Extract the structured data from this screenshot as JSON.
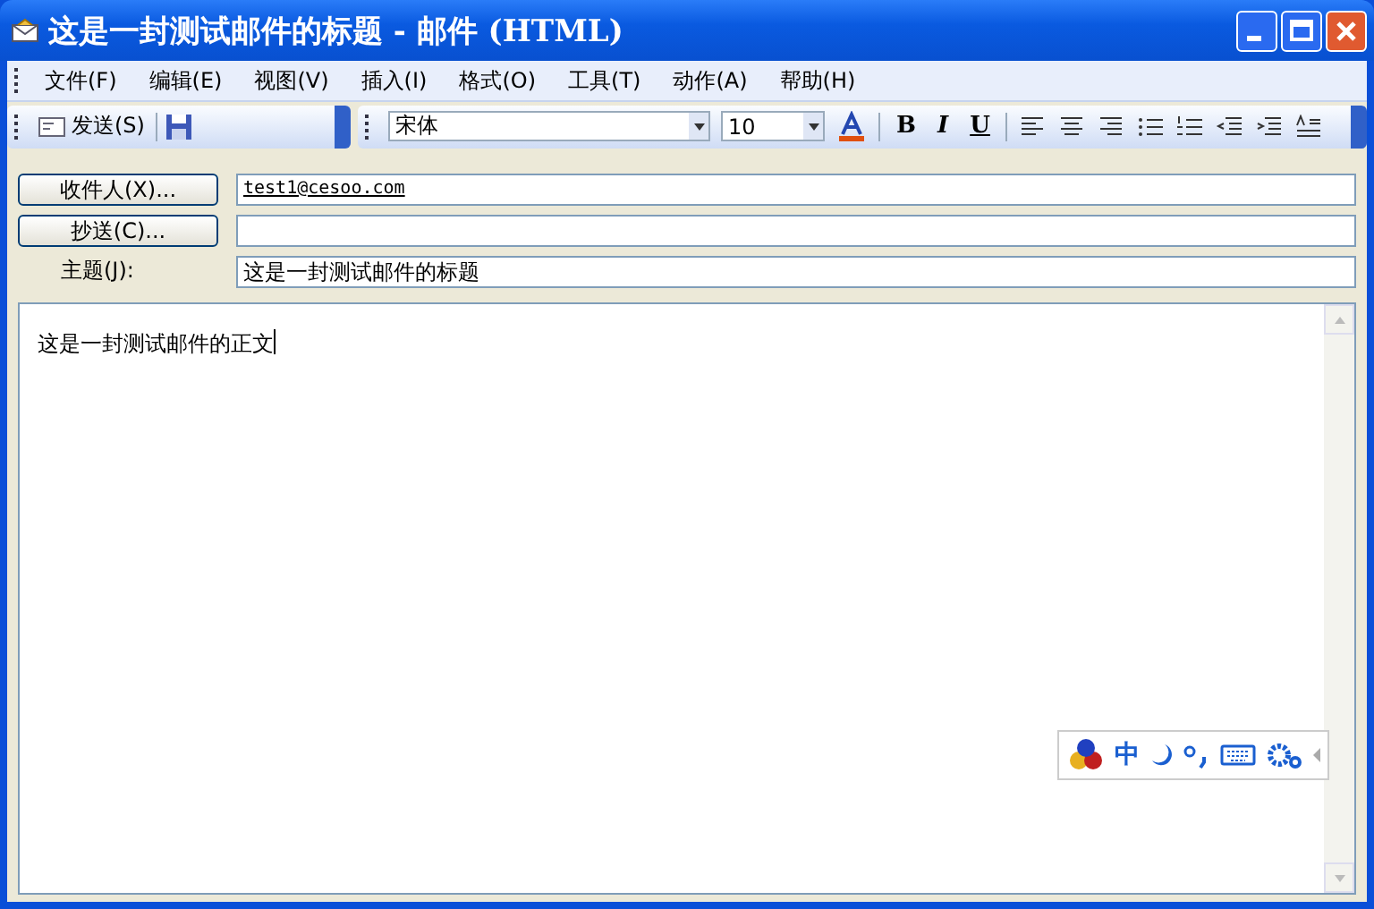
{
  "window": {
    "title": "这是一封测试邮件的标题 - 邮件 (HTML)"
  },
  "menu": [
    "文件(F)",
    "编辑(E)",
    "视图(V)",
    "插入(I)",
    "格式(O)",
    "工具(T)",
    "动作(A)",
    "帮助(H)"
  ],
  "toolbar": {
    "send": "发送(S)",
    "font": "宋体",
    "size": "10"
  },
  "format": {
    "bold": "B",
    "italic": "I",
    "underline": "U"
  },
  "header": {
    "to_button": "收件人(X)...",
    "to": "test1@cesoo.com",
    "cc_button": "抄送(C)...",
    "subject_label": "主题(J):",
    "subject": "这是一封测试邮件的标题"
  },
  "body": "这是一封测试邮件的正文",
  "ime": {
    "chinese": "中"
  }
}
